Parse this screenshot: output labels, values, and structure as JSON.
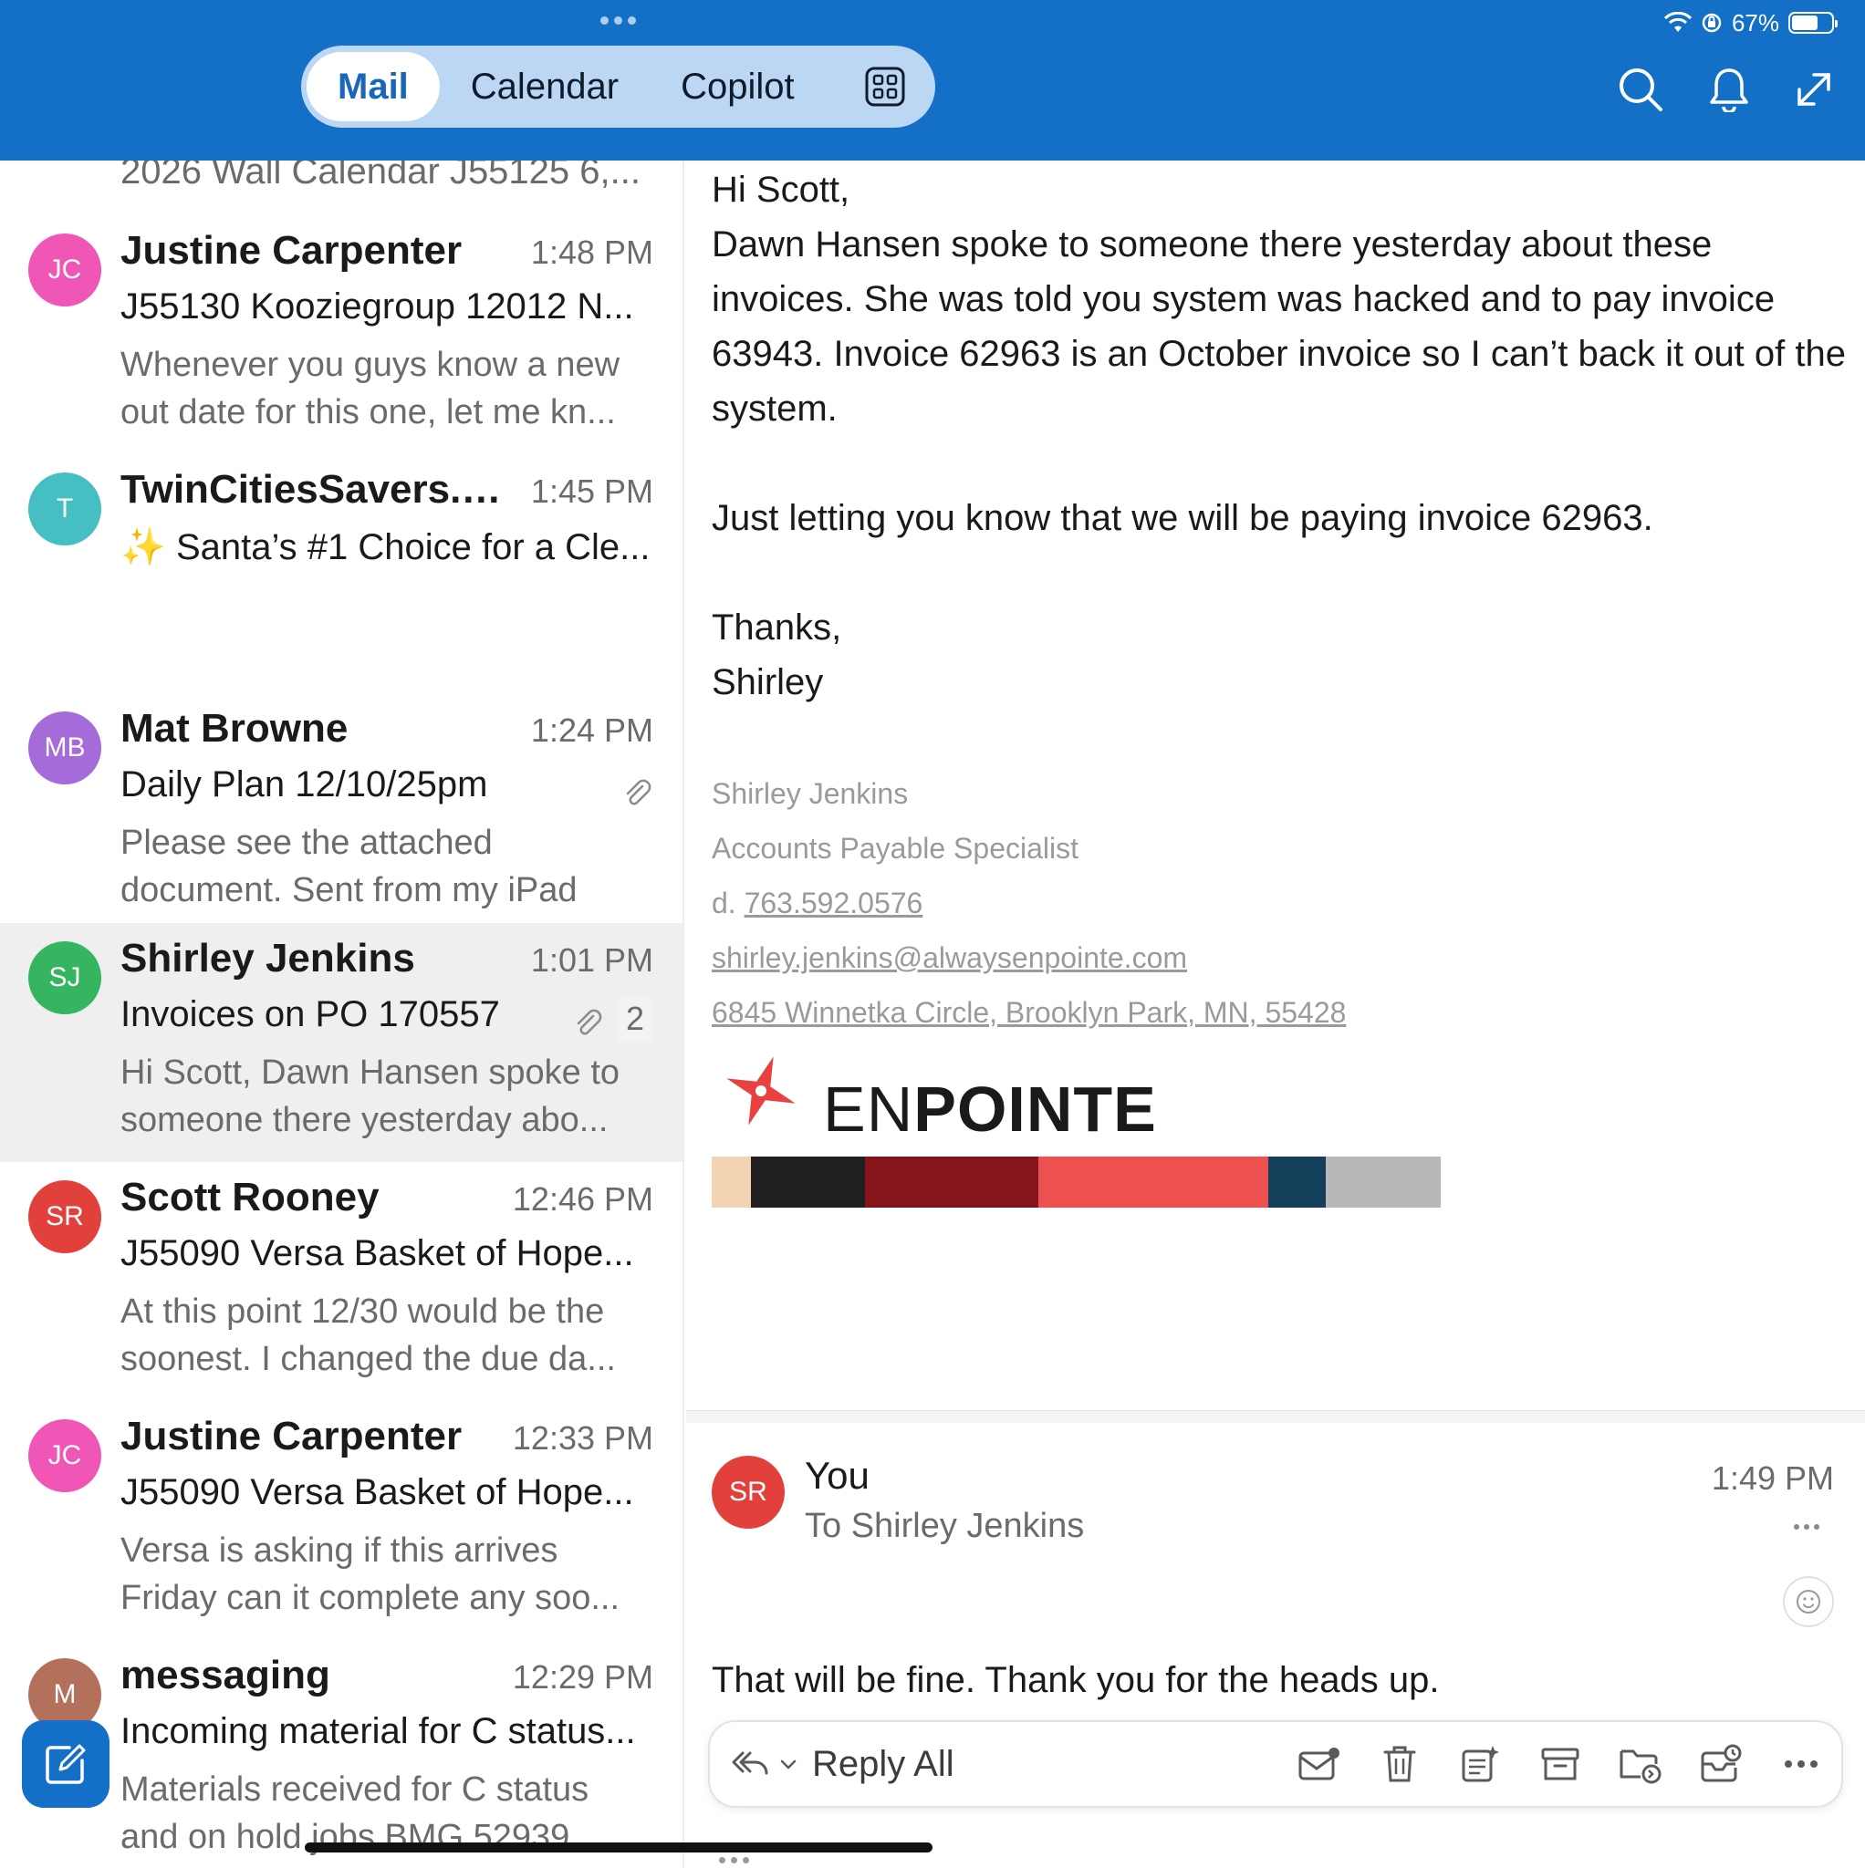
{
  "status_bar": {
    "battery": "67%"
  },
  "nav": {
    "tabs": [
      {
        "label": "Mail",
        "active": true
      },
      {
        "label": "Calendar",
        "active": false
      },
      {
        "label": "Copilot",
        "active": false
      }
    ],
    "apps_icon": "apps-grid-icon",
    "right_icons": [
      "search-icon",
      "bell-icon",
      "expand-icon"
    ]
  },
  "mail_list": {
    "clipped_top_subject": "2026 Wall Calendar J55125 6,...",
    "items": [
      {
        "initials": "JC",
        "avatar_color": "#ef56b6",
        "sender": "Justine Carpenter",
        "time": "1:48 PM",
        "subject": "J55130 Kooziegroup 12012 N...",
        "preview_1": "Whenever you guys know a new",
        "preview_2": "out date for this one, let me kn..."
      },
      {
        "initials": "T",
        "avatar_color": "#45bfc1",
        "sender": "TwinCitiesSavers.co...",
        "time": "1:45 PM",
        "subject": "Santa’s #1 Choice for a Cle...",
        "sparkle": "✨",
        "preview_1": "",
        "preview_2": ""
      },
      {
        "initials": "MB",
        "avatar_color": "#a56bd9",
        "sender": "Mat Browne",
        "time": "1:24 PM",
        "subject": "Daily Plan 12/10/25pm",
        "preview_1": "Please see the attached",
        "preview_2": "document. Sent from my iPad",
        "attachment": true
      },
      {
        "initials": "SJ",
        "avatar_color": "#35b55f",
        "sender": "Shirley Jenkins",
        "time": "1:01 PM",
        "subject": "Invoices on PO 170557",
        "preview_1": "Hi Scott, Dawn Hansen spoke to",
        "preview_2": "someone there yesterday abo...",
        "attachment": true,
        "count": "2",
        "selected": true
      },
      {
        "initials": "SR",
        "avatar_color": "#e2403b",
        "sender": "Scott Rooney",
        "time": "12:46 PM",
        "subject": "J55090 Versa Basket of Hope...",
        "preview_1": "At this point 12/30 would be the",
        "preview_2": "soonest. I changed the due da..."
      },
      {
        "initials": "JC",
        "avatar_color": "#ef56b6",
        "sender": "Justine Carpenter",
        "time": "12:33 PM",
        "subject": "J55090 Versa Basket of Hope...",
        "preview_1": "Versa is asking if this arrives",
        "preview_2": "Friday can it complete any soo..."
      },
      {
        "initials": "M",
        "avatar_color": "#b3705b",
        "sender": "messaging",
        "time": "12:29 PM",
        "subject": "Incoming material for C status...",
        "preview_1": "Materials received for C status",
        "preview_2": "and on hold jobs BMG 52939..."
      }
    ]
  },
  "message": {
    "body": [
      "Hi Scott,",
      "Dawn Hansen spoke to someone there yesterday about these invoices.  She was told you system was hacked and to pay invoice 63943.  Invoice 62963 is an October invoice so I can’t back it out of the system.",
      "",
      "Just letting you know that we will be paying invoice 62963.",
      "",
      "Thanks,",
      "Shirley"
    ],
    "signature": {
      "name": "Shirley Jenkins",
      "title": "Accounts Payable Specialist",
      "phone_prefix": "d.",
      "phone": "763.592.0576",
      "email": "shirley.jenkins@alwaysenpointe.com",
      "address": "6845 Winnetka Circle, Brooklyn Park, MN, 55428",
      "logo_text_light": "EN",
      "logo_text_bold": "POINTE",
      "logo_color": "#e8413f"
    },
    "color_strip": [
      {
        "color": "#f2d3b2",
        "share": 0.054
      },
      {
        "color": "#202020",
        "share": 0.157
      },
      {
        "color": "#86151b",
        "share": 0.24
      },
      {
        "color": "#ed5050",
        "share": 0.318
      },
      {
        "color": "#143f5a",
        "share": 0.08
      },
      {
        "color": "#b8b8b8",
        "share": 0.159
      }
    ]
  },
  "reply": {
    "initials": "SR",
    "sender": "You",
    "to": "To Shirley Jenkins",
    "time": "1:49 PM",
    "text": "That will be fine.  Thank you for the heads up."
  },
  "actions": {
    "reply_all_label": "Reply All",
    "icons": [
      "mark-unread-icon",
      "trash-icon",
      "summarize-icon",
      "archive-icon",
      "move-folder-icon",
      "snooze-icon",
      "more-icon"
    ]
  }
}
